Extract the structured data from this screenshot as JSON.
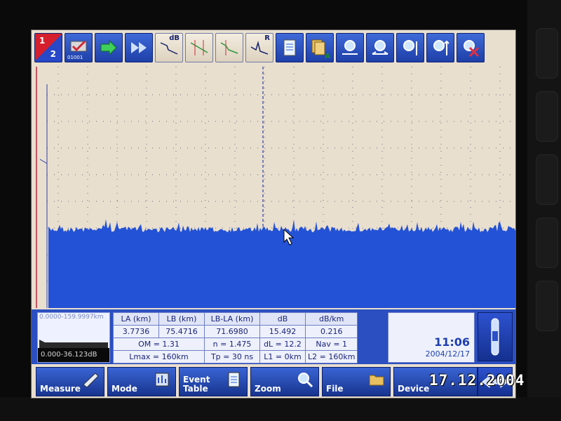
{
  "toolbar": {
    "channel_top": "1",
    "channel_bottom": "2",
    "btn_sub": "01001",
    "db_label": "dB",
    "r_label": "R",
    "a_label": "A"
  },
  "mini_view": {
    "range_text": "0.0000-159.9997km",
    "db_range": "0.000-36.123dB"
  },
  "measurements": {
    "headers": [
      "LA (km)",
      "LB (km)",
      "LB-LA (km)",
      "dB",
      "dB/km"
    ],
    "values": [
      "3.7736",
      "75.4716",
      "71.6980",
      "15.492",
      "0.216"
    ],
    "row3": [
      "OM = 1.31",
      "n = 1.475",
      "dL = 12.2",
      "Nav = 1"
    ],
    "row4": [
      "Lmax = 160km",
      "Tp = 30 ns",
      "L1 = 0km",
      "L2 = 160km"
    ]
  },
  "clock": {
    "time": "11:06",
    "date": "2004/12/17"
  },
  "bottom_buttons": {
    "measure": "Measure",
    "mode": "Mode",
    "event_table_1": "Event",
    "event_table_2": "Table",
    "zoom": "Zoom",
    "file": "File",
    "device": "Device"
  },
  "photo_stamp": "17.12.2004",
  "colors": {
    "trace": "#2352d6",
    "plot_bg": "#e9dfcf",
    "button": "#2a4fc6",
    "marker_a": "#c0283c",
    "marker_b": "#2b3fa8"
  }
}
